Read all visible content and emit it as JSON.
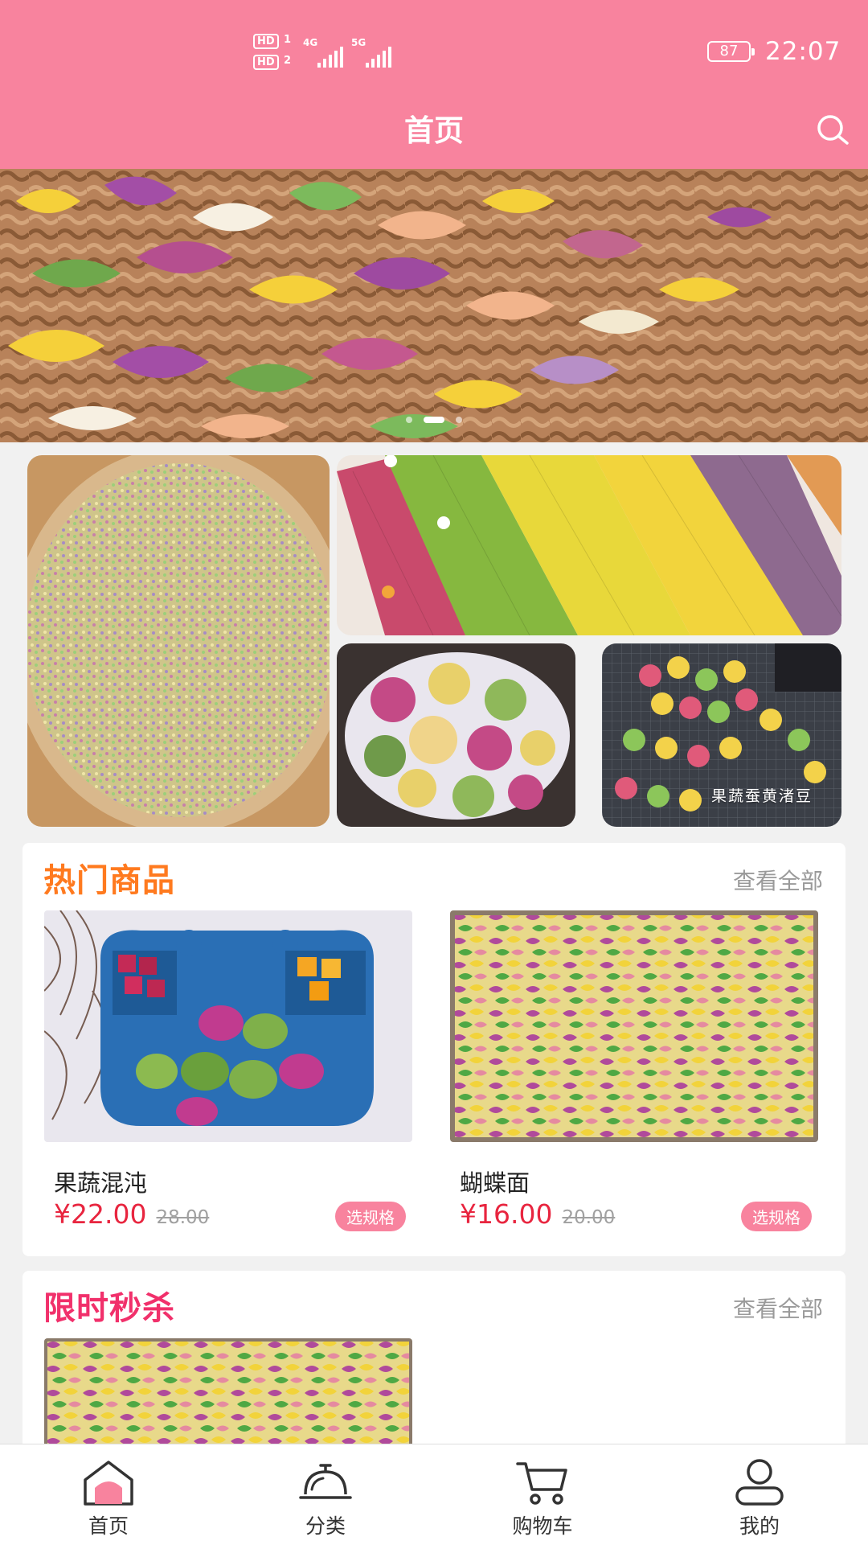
{
  "status_bar": {
    "sim1_badge": "HD",
    "sim1_num": "1",
    "sim2_badge": "HD",
    "sim2_num": "2",
    "network1": "4G",
    "network2": "5G",
    "battery": "87",
    "time": "22:07"
  },
  "header": {
    "title": "首页",
    "search_icon": "search-icon"
  },
  "banner": {
    "slide_count": 3,
    "active_index": 1
  },
  "collage": {
    "caption": "果蔬蚕黄渚豆"
  },
  "hot_section": {
    "title": "热门商品",
    "view_all": "查看全部",
    "products": [
      {
        "name": "果蔬混沌",
        "price": "¥22.00",
        "original_price": "28.00",
        "spec_button": "选规格"
      },
      {
        "name": "蝴蝶面",
        "price": "¥16.00",
        "original_price": "20.00",
        "spec_button": "选规格"
      }
    ]
  },
  "flash_section": {
    "title": "限时秒杀",
    "view_all": "查看全部"
  },
  "bottom_nav": {
    "items": [
      {
        "label": "首页",
        "icon": "home-icon",
        "active": true
      },
      {
        "label": "分类",
        "icon": "service-bell-icon",
        "active": false
      },
      {
        "label": "购物车",
        "icon": "cart-icon",
        "active": false
      },
      {
        "label": "我的",
        "icon": "user-icon",
        "active": false
      }
    ]
  },
  "colors": {
    "brand_pink": "#f8839e",
    "price_red": "#e8253f",
    "hot_orange": "#ff7a1f",
    "flash_pink": "#f1306b"
  }
}
